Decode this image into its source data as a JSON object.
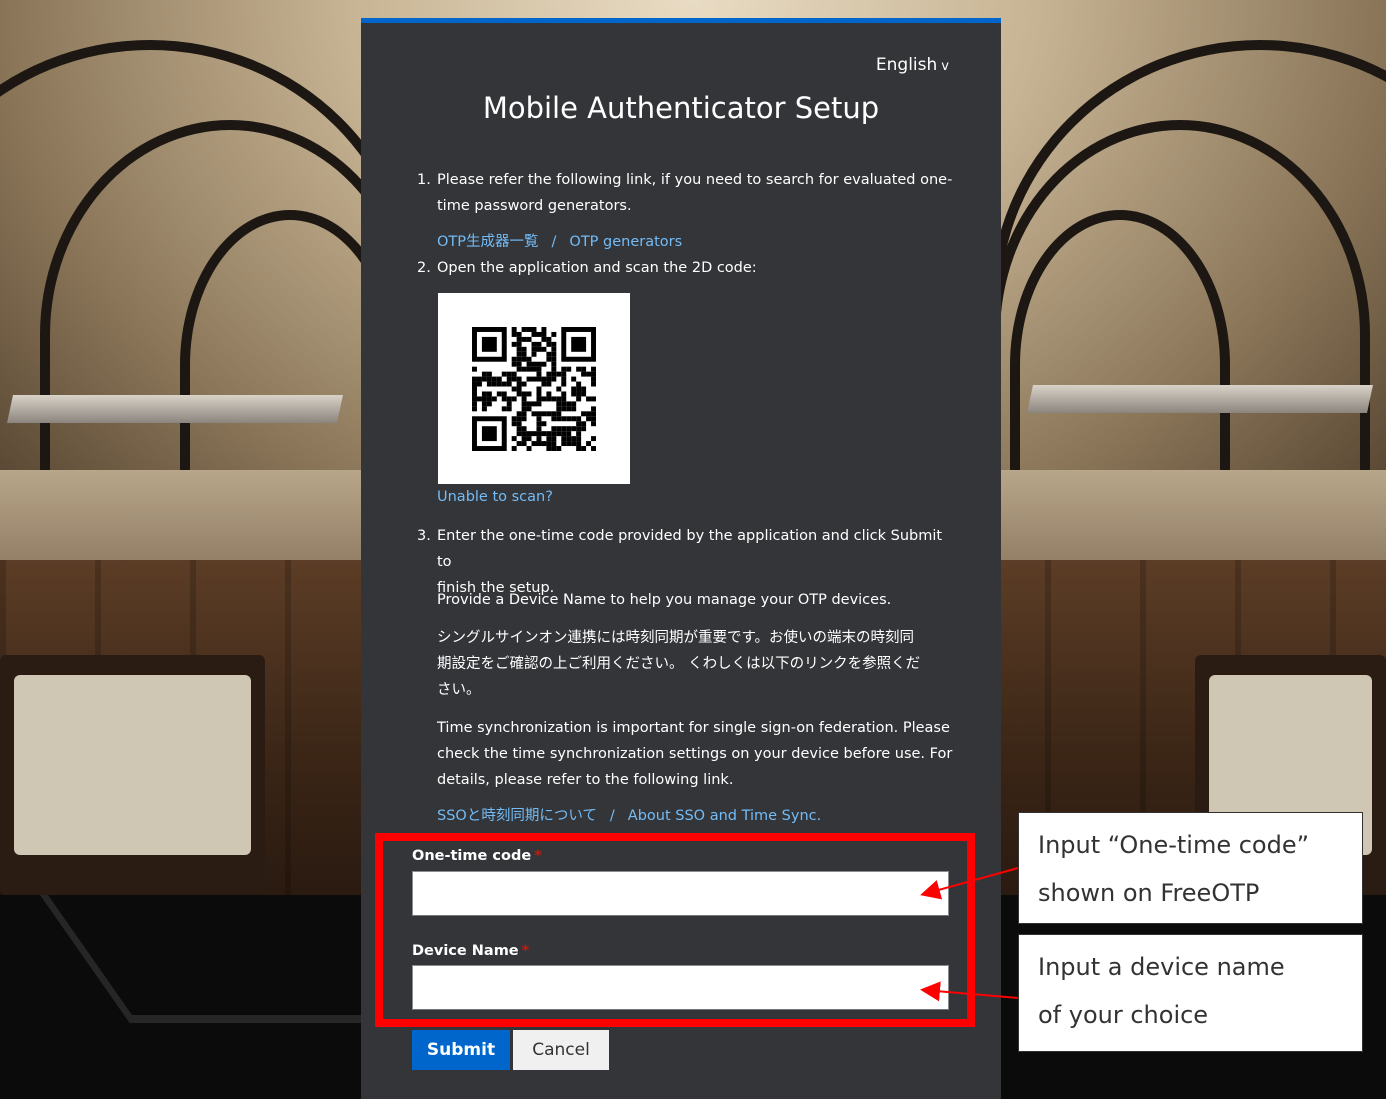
{
  "page": {
    "language_label": "English",
    "title": "Mobile Authenticator Setup"
  },
  "steps": {
    "step1_number": "1.",
    "step1_text_line1": "Please refer the following link, if you need to search for evaluated one-",
    "step1_text_line2": "time password generators.",
    "otp_link_ja": "OTP生成器一覧",
    "link_separator": "/",
    "otp_link_en": "OTP generators",
    "step2_number": "2.",
    "step2_text": "Open the application and scan the 2D code:",
    "unable_to_scan": "Unable to scan?",
    "step3_number": "3.",
    "step3_text_line1": "Enter the one-time code provided by the application and click Submit to",
    "step3_text_line2": "finish the setup.",
    "device_name_hint": "Provide a Device Name to help you manage your OTP devices.",
    "sync_ja_line1": "シングルサインオン連携には時刻同期が重要です。お使いの端末の時刻同",
    "sync_ja_line2": "期設定をご確認の上ご利用ください。 くわしくは以下のリンクを参照くだ",
    "sync_ja_line3": "さい。",
    "sync_en_line1": "Time synchronization is important for single sign-on federation. Please",
    "sync_en_line2": "check the time synchronization settings on your device before use. For",
    "sync_en_line3": "details, please refer to the following link.",
    "sso_link_ja": "SSOと時刻同期について",
    "sso_link_en": "About SSO and Time Sync."
  },
  "form": {
    "otp_label": "One-time code",
    "otp_value": "",
    "device_label": "Device Name",
    "device_value": "",
    "required_mark": "*",
    "submit_label": "Submit",
    "cancel_label": "Cancel"
  },
  "annotations": {
    "callout1_line1": "Input “One-time code”",
    "callout1_line2": "shown on FreeOTP",
    "callout2_line1": "Input a device name",
    "callout2_line2": "of your choice"
  },
  "colors": {
    "card_background": "#333538",
    "accent_blue": "#0066cc",
    "link": "#73bcf7",
    "annotation_red": "#ff0000"
  }
}
